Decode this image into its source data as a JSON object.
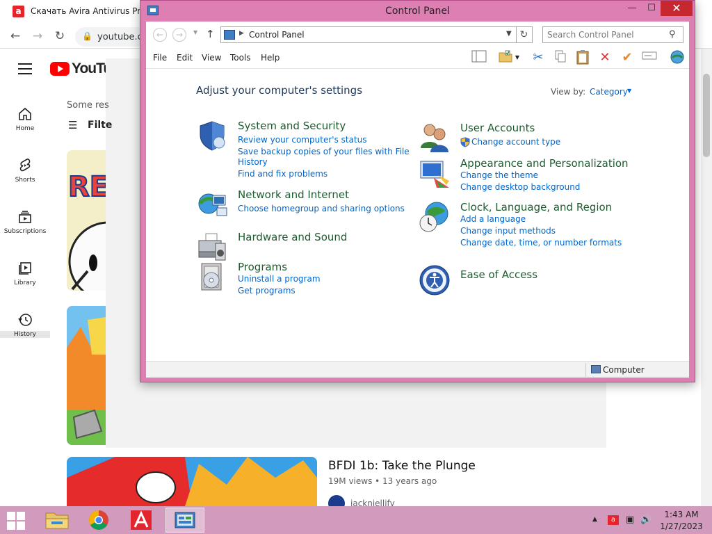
{
  "browser": {
    "tab_title": "Скачать Avira Antivirus Pro",
    "url": "youtube.c"
  },
  "youtube": {
    "logo_text": "YouTub",
    "sidebar": [
      {
        "label": "Home",
        "icon": "home-icon"
      },
      {
        "label": "Shorts",
        "icon": "shorts-icon"
      },
      {
        "label": "Subscriptions",
        "icon": "subscriptions-icon"
      },
      {
        "label": "Library",
        "icon": "library-icon"
      },
      {
        "label": "History",
        "icon": "history-icon"
      }
    ],
    "some_results": "Some res",
    "filter_label": "Filte",
    "video": {
      "title": "BFDI 1b: Take the Plunge",
      "meta": "19M views • 13 years ago",
      "channel": "jacknjellify"
    }
  },
  "control_panel": {
    "window_title": "Control Panel",
    "address": "Control Panel",
    "search_placeholder": "Search Control Panel",
    "menu": [
      "File",
      "Edit",
      "View",
      "Tools",
      "Help"
    ],
    "heading": "Adjust your computer's settings",
    "view_by_label": "View by:",
    "view_by_value": "Category",
    "categories_left": [
      {
        "title": "System and Security",
        "icon": "shield-icon",
        "links": [
          "Review your computer's status",
          "Save backup copies of your files with File",
          "History",
          "Find and fix problems"
        ]
      },
      {
        "title": "Network and Internet",
        "icon": "network-globe-icon",
        "links": [
          "Choose homegroup and sharing options"
        ]
      },
      {
        "title": "Hardware and Sound",
        "icon": "printer-speaker-icon",
        "links": []
      },
      {
        "title": "Programs",
        "icon": "programs-disc-icon",
        "links": [
          "Uninstall a program",
          "Get programs"
        ]
      }
    ],
    "categories_right": [
      {
        "title": "User Accounts",
        "icon": "users-icon",
        "links": [
          "Change account type"
        ]
      },
      {
        "title": "Appearance and Personalization",
        "icon": "monitor-palette-icon",
        "links": [
          "Change the theme",
          "Change desktop background"
        ]
      },
      {
        "title": "Clock, Language, and Region",
        "icon": "globe-clock-icon",
        "links": [
          "Add a language",
          "Change input methods",
          "Change date, time, or number formats"
        ]
      },
      {
        "title": "Ease of Access",
        "icon": "ease-of-access-icon",
        "links": []
      }
    ],
    "status_text": "Computer"
  },
  "taskbar": {
    "time": "1:43 AM",
    "date": "1/27/2023"
  },
  "colors": {
    "window_frame": "#dd7fb3",
    "taskbar": "#d29bbd",
    "link_blue": "#0066cc",
    "category_green": "#1e5b30",
    "heading_navy": "#1e395b",
    "close_red": "#c7282f"
  }
}
